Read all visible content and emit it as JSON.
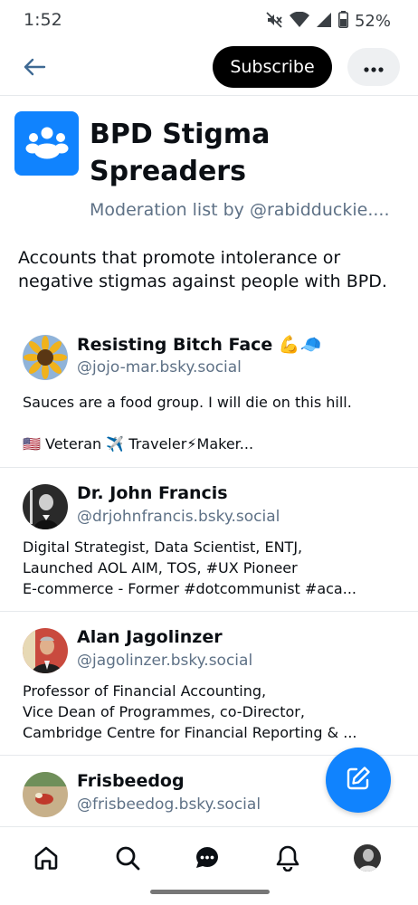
{
  "status_bar": {
    "time": "1:52",
    "battery": "52%",
    "icons": [
      "mute-icon",
      "wifi-icon",
      "signal-icon",
      "battery-icon"
    ]
  },
  "header": {
    "back_icon": "back-arrow-icon",
    "subscribe_label": "Subscribe",
    "more_icon": "more-dots-icon"
  },
  "list": {
    "avatar_icon": "group-people-icon",
    "title": "BPD Stigma Spreaders",
    "byline": "Moderation list by @rabidduckie....",
    "description": "Accounts that promote intolerance or negative stigmas against people with BPD.",
    "accent_color": "#1083fe"
  },
  "members": [
    {
      "name": "Resisting Bitch Face 💪🧢",
      "handle": "@jojo-mar.bsky.social",
      "bio": [
        "Sauces are a food group. I will die on this hill.",
        "",
        "🇺🇸 Veteran ✈️ Traveler⚡Maker..."
      ]
    },
    {
      "name": "Dr. John Francis",
      "handle": "@drjohnfrancis.bsky.social",
      "bio": [
        "Digital Strategist, Data Scientist, ENTJ,",
        "Launched AOL AIM, TOS, #UX Pioneer",
        "E-commerce - Former #dotcommunist #aca..."
      ]
    },
    {
      "name": "Alan Jagolinzer",
      "handle": "@jagolinzer.bsky.social",
      "bio": [
        "Professor of Financial Accounting,",
        "Vice Dean of Programmes, co-Director,",
        "Cambridge Centre for Financial Reporting & ..."
      ]
    },
    {
      "name": "Frisbeedog",
      "handle": "@frisbeedog.bsky.social",
      "bio": []
    }
  ],
  "fab": {
    "icon": "compose-icon"
  },
  "bottom_nav": {
    "items": [
      "home-icon",
      "search-icon",
      "chat-icon",
      "notifications-icon",
      "profile-avatar"
    ]
  }
}
